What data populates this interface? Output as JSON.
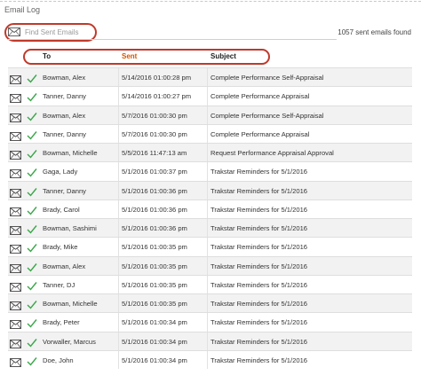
{
  "page": {
    "title": "Email Log"
  },
  "search": {
    "placeholder": "Find Sent Emails",
    "icon": "envelope-icon"
  },
  "summary": {
    "count_text": "1057 sent emails found"
  },
  "table": {
    "headers": {
      "to": "To",
      "sent": "Sent",
      "subject": "Subject"
    },
    "row_icons": [
      "envelope-icon",
      "checkmark-icon"
    ],
    "colors": {
      "check": "#3aa64a",
      "highlight_ring": "#c0392b",
      "sort_header": "#d35400"
    },
    "rows": [
      {
        "to": "Bowman, Alex",
        "sent": "5/14/2016 01:00:28 pm",
        "subject": "Complete Performance Self-Appraisal"
      },
      {
        "to": "Tanner, Danny",
        "sent": "5/14/2016 01:00:27 pm",
        "subject": "Complete Performance Appraisal"
      },
      {
        "to": "Bowman, Alex",
        "sent": "5/7/2016 01:00:30 pm",
        "subject": "Complete Performance Self-Appraisal"
      },
      {
        "to": "Tanner, Danny",
        "sent": "5/7/2016 01:00:30 pm",
        "subject": "Complete Performance Appraisal"
      },
      {
        "to": "Bowman, Michelle",
        "sent": "5/5/2016 11:47:13 am",
        "subject": "Request Performance Appraisal Approval"
      },
      {
        "to": "Gaga, Lady",
        "sent": "5/1/2016 01:00:37 pm",
        "subject": "Trakstar Reminders for 5/1/2016"
      },
      {
        "to": "Tanner, Danny",
        "sent": "5/1/2016 01:00:36 pm",
        "subject": "Trakstar Reminders for 5/1/2016"
      },
      {
        "to": "Brady, Carol",
        "sent": "5/1/2016 01:00:36 pm",
        "subject": "Trakstar Reminders for 5/1/2016"
      },
      {
        "to": "Bowman, Sashimi",
        "sent": "5/1/2016 01:00:36 pm",
        "subject": "Trakstar Reminders for 5/1/2016"
      },
      {
        "to": "Brady, Mike",
        "sent": "5/1/2016 01:00:35 pm",
        "subject": "Trakstar Reminders for 5/1/2016"
      },
      {
        "to": "Bowman, Alex",
        "sent": "5/1/2016 01:00:35 pm",
        "subject": "Trakstar Reminders for 5/1/2016"
      },
      {
        "to": "Tanner, DJ",
        "sent": "5/1/2016 01:00:35 pm",
        "subject": "Trakstar Reminders for 5/1/2016"
      },
      {
        "to": "Bowman, Michelle",
        "sent": "5/1/2016 01:00:35 pm",
        "subject": "Trakstar Reminders for 5/1/2016"
      },
      {
        "to": "Brady, Peter",
        "sent": "5/1/2016 01:00:34 pm",
        "subject": "Trakstar Reminders for 5/1/2016"
      },
      {
        "to": "Vorwaller, Marcus",
        "sent": "5/1/2016 01:00:34 pm",
        "subject": "Trakstar Reminders for 5/1/2016"
      },
      {
        "to": "Doe, John",
        "sent": "5/1/2016 01:00:34 pm",
        "subject": "Trakstar Reminders for 5/1/2016"
      }
    ]
  }
}
